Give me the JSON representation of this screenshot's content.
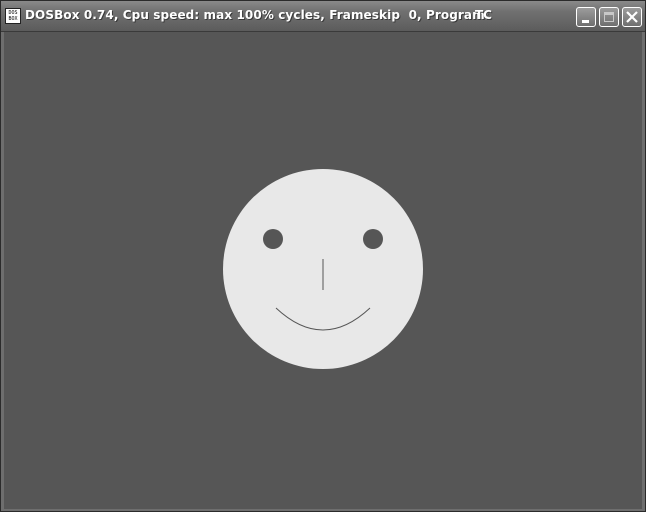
{
  "window": {
    "app_icon_line1": "DOS",
    "app_icon_line2": "BOX",
    "title": "DOSBox 0.74, Cpu speed: max 100% cycles, Frameskip  0, Program:",
    "program": "TC"
  },
  "controls": {
    "minimize_icon": "minimize-icon",
    "maximize_icon": "maximize-icon",
    "close_icon": "close-icon"
  },
  "canvas": {
    "background_color": "#565656",
    "face_color": "#e8e8e8",
    "feature_color": "#565656"
  }
}
